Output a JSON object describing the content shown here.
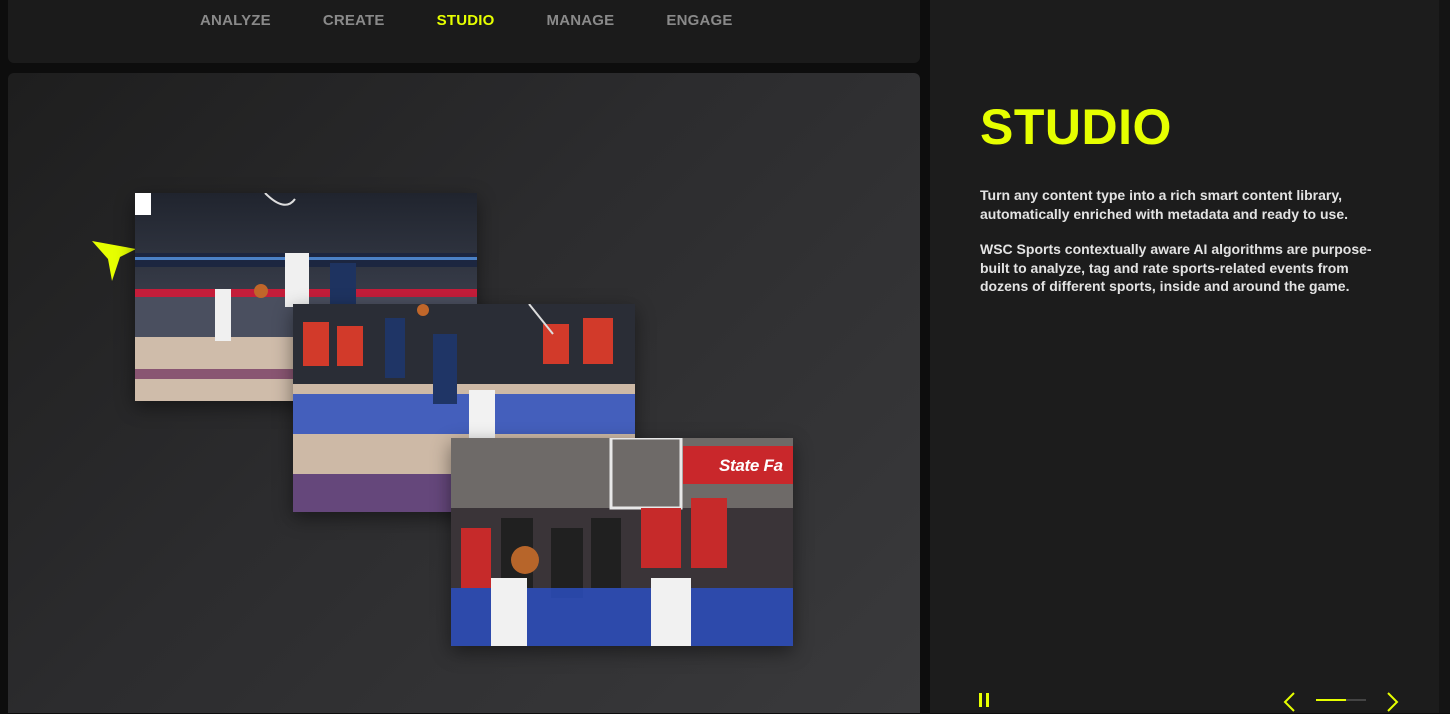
{
  "nav": {
    "tabs": [
      {
        "label": "ANALYZE",
        "active": false
      },
      {
        "label": "CREATE",
        "active": false
      },
      {
        "label": "STUDIO",
        "active": true
      },
      {
        "label": "MANAGE",
        "active": false
      },
      {
        "label": "ENGAGE",
        "active": false
      }
    ]
  },
  "media": {
    "cards": [
      {
        "name": "basketball-highlight-card-1",
        "subject": "player driving down court"
      },
      {
        "name": "basketball-highlight-card-2",
        "subject": "layup over defender at the rim"
      },
      {
        "name": "basketball-highlight-card-3",
        "subject": "courtside crowd and loose ball"
      }
    ],
    "sign_text": "State Fa",
    "logo_icon": "arrow-cursor-logo-icon"
  },
  "side": {
    "title": "STUDIO",
    "paragraph_1": "Turn any content type into a rich smart content library, automatically enriched with metadata and ready to use.",
    "paragraph_2": "WSC Sports contextually aware AI algorithms are purpose-built to analyze, tag and rate sports-related events from dozens of different sports, inside and around the game."
  },
  "controls": {
    "pause_icon": "pause-icon",
    "prev_icon": "chevron-left-icon",
    "next_icon": "chevron-right-icon",
    "progress": 0.6
  },
  "colors": {
    "accent": "#e6ff00",
    "panel": "#1b1b1b",
    "side_panel": "#1c1c1c",
    "text": "#e3e3e3",
    "inactive_tab": "#8a8a8a"
  }
}
